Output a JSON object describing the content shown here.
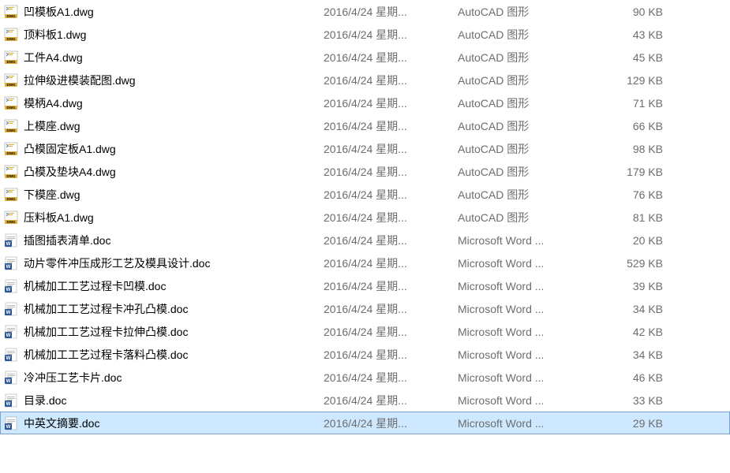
{
  "files": [
    {
      "name": "凹模板A1.dwg",
      "date": "2016/4/24 星期...",
      "type": "AutoCAD 图形",
      "size": "90 KB",
      "icon": "dwg"
    },
    {
      "name": "顶料板1.dwg",
      "date": "2016/4/24 星期...",
      "type": "AutoCAD 图形",
      "size": "43 KB",
      "icon": "dwg"
    },
    {
      "name": "工件A4.dwg",
      "date": "2016/4/24 星期...",
      "type": "AutoCAD 图形",
      "size": "45 KB",
      "icon": "dwg"
    },
    {
      "name": "拉伸级进模装配图.dwg",
      "date": "2016/4/24 星期...",
      "type": "AutoCAD 图形",
      "size": "129 KB",
      "icon": "dwg"
    },
    {
      "name": "模柄A4.dwg",
      "date": "2016/4/24 星期...",
      "type": "AutoCAD 图形",
      "size": "71 KB",
      "icon": "dwg"
    },
    {
      "name": "上模座.dwg",
      "date": "2016/4/24 星期...",
      "type": "AutoCAD 图形",
      "size": "66 KB",
      "icon": "dwg"
    },
    {
      "name": "凸模固定板A1.dwg",
      "date": "2016/4/24 星期...",
      "type": "AutoCAD 图形",
      "size": "98 KB",
      "icon": "dwg"
    },
    {
      "name": "凸模及垫块A4.dwg",
      "date": "2016/4/24 星期...",
      "type": "AutoCAD 图形",
      "size": "179 KB",
      "icon": "dwg"
    },
    {
      "name": "下模座.dwg",
      "date": "2016/4/24 星期...",
      "type": "AutoCAD 图形",
      "size": "76 KB",
      "icon": "dwg"
    },
    {
      "name": "压料板A1.dwg",
      "date": "2016/4/24 星期...",
      "type": "AutoCAD 图形",
      "size": "81 KB",
      "icon": "dwg"
    },
    {
      "name": "插图插表清单.doc",
      "date": "2016/4/24 星期...",
      "type": "Microsoft Word ...",
      "size": "20 KB",
      "icon": "doc"
    },
    {
      "name": "动片零件冲压成形工艺及模具设计.doc",
      "date": "2016/4/24 星期...",
      "type": "Microsoft Word ...",
      "size": "529 KB",
      "icon": "doc"
    },
    {
      "name": "机械加工工艺过程卡凹模.doc",
      "date": "2016/4/24 星期...",
      "type": "Microsoft Word ...",
      "size": "39 KB",
      "icon": "doc"
    },
    {
      "name": "机械加工工艺过程卡冲孔凸模.doc",
      "date": "2016/4/24 星期...",
      "type": "Microsoft Word ...",
      "size": "34 KB",
      "icon": "doc"
    },
    {
      "name": "机械加工工艺过程卡拉伸凸模.doc",
      "date": "2016/4/24 星期...",
      "type": "Microsoft Word ...",
      "size": "42 KB",
      "icon": "doc"
    },
    {
      "name": "机械加工工艺过程卡落料凸模.doc",
      "date": "2016/4/24 星期...",
      "type": "Microsoft Word ...",
      "size": "34 KB",
      "icon": "doc"
    },
    {
      "name": "冷冲压工艺卡片.doc",
      "date": "2016/4/24 星期...",
      "type": "Microsoft Word ...",
      "size": "46 KB",
      "icon": "doc"
    },
    {
      "name": "目录.doc",
      "date": "2016/4/24 星期...",
      "type": "Microsoft Word ...",
      "size": "33 KB",
      "icon": "doc"
    },
    {
      "name": "中英文摘要.doc",
      "date": "2016/4/24 星期...",
      "type": "Microsoft Word ...",
      "size": "29 KB",
      "icon": "doc",
      "selected": true
    }
  ]
}
